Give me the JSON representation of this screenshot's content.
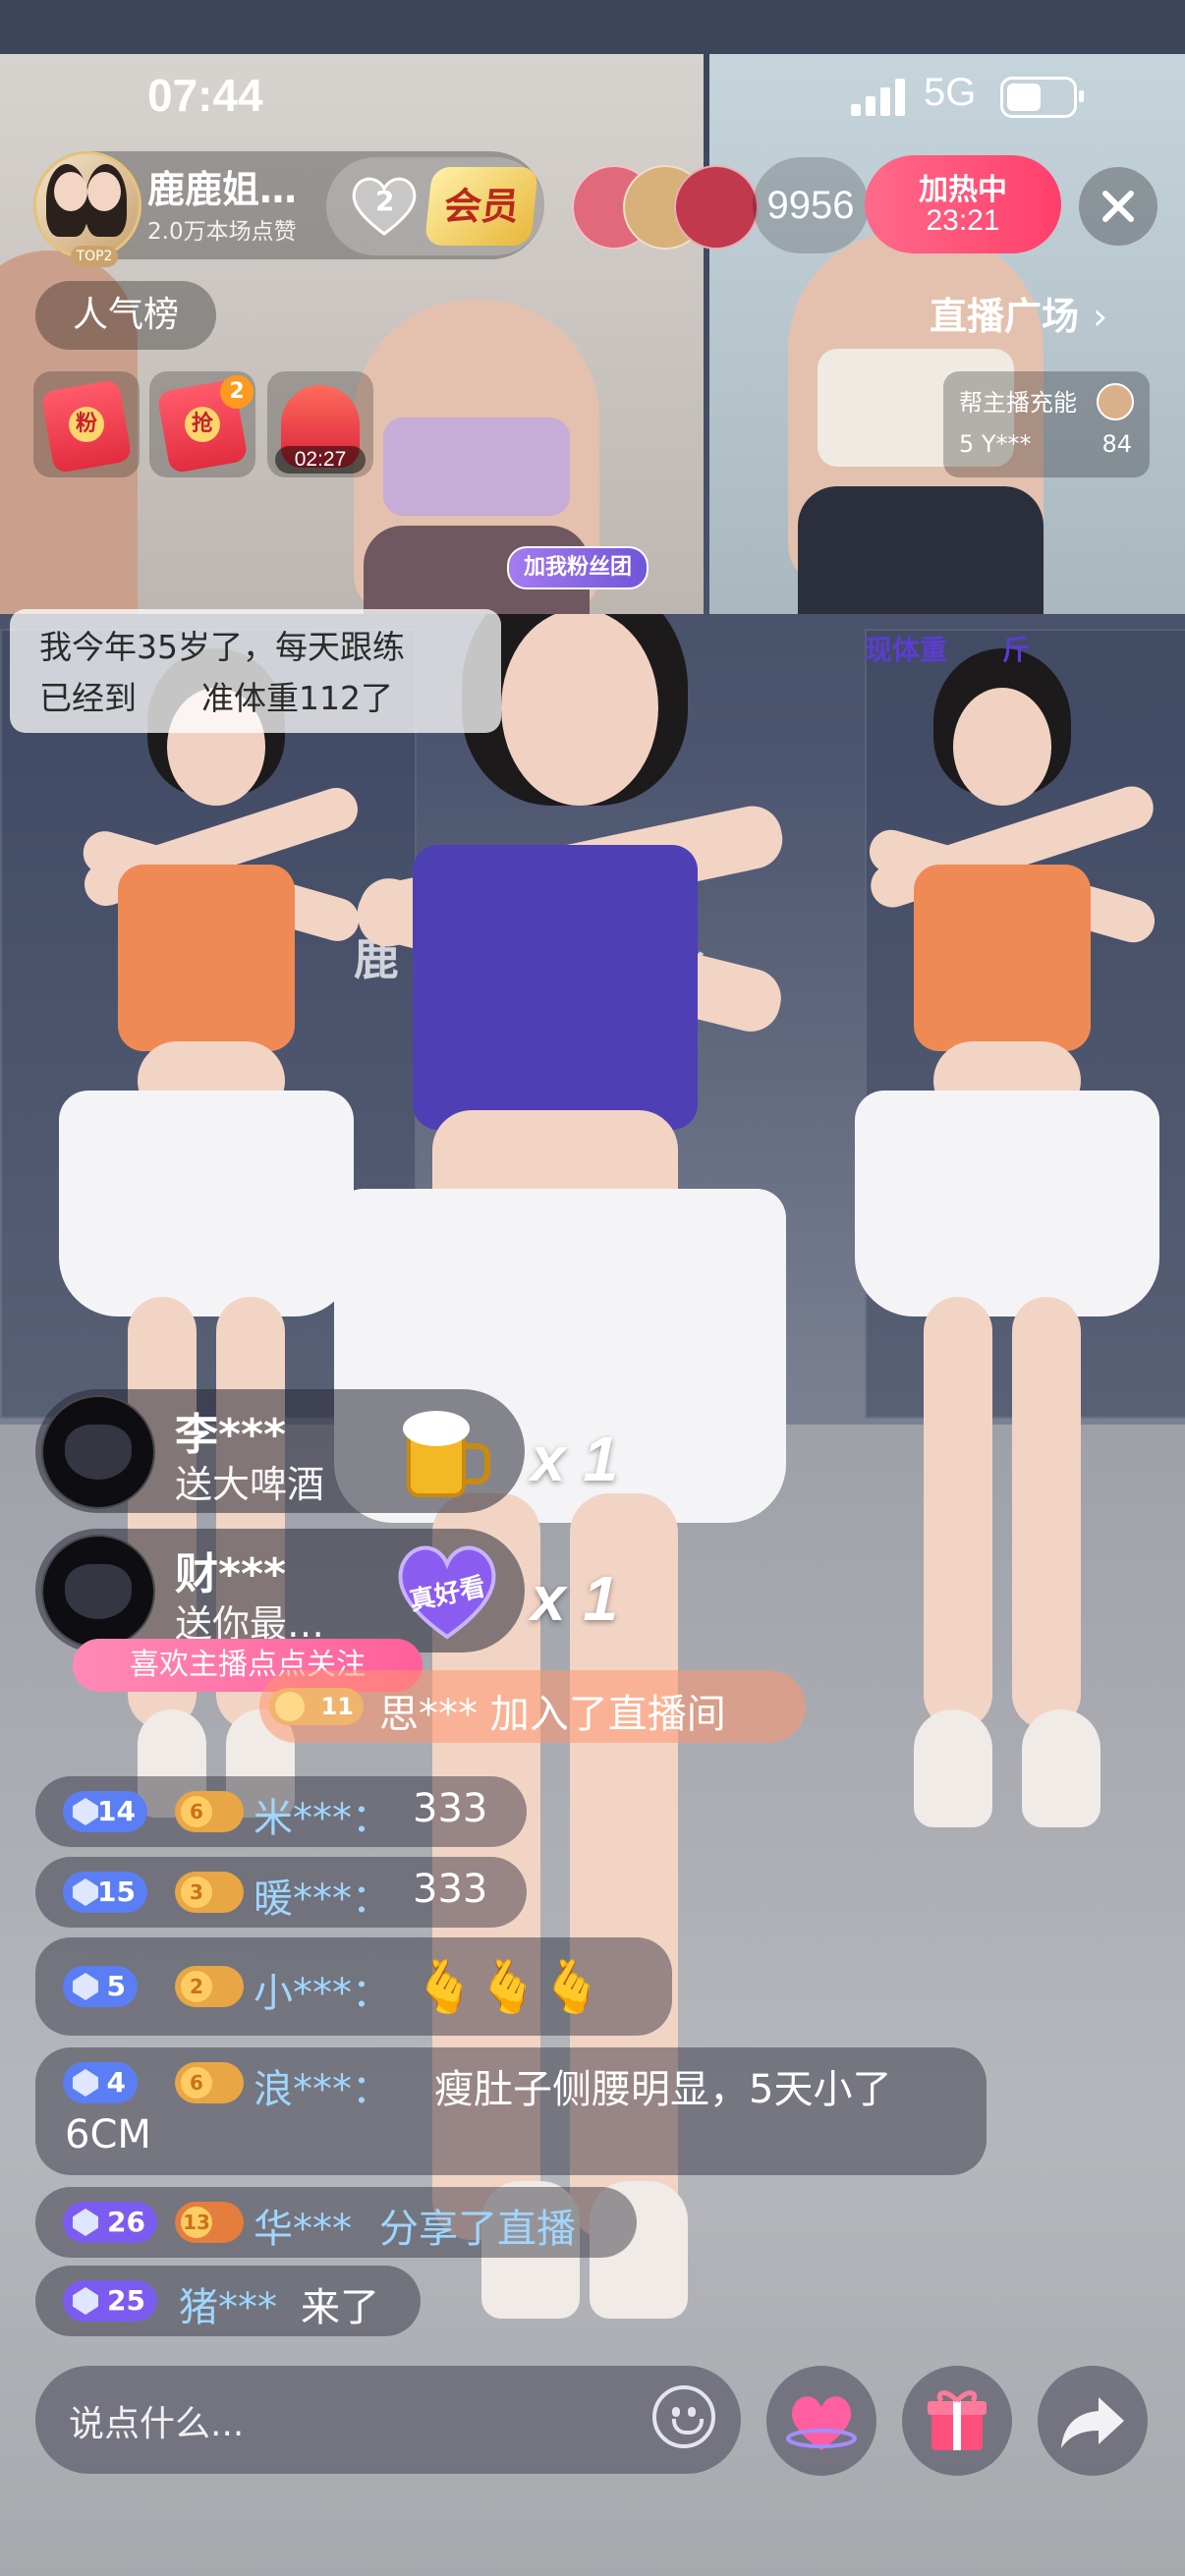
{
  "status_bar": {
    "time": "07:44",
    "network": "5G"
  },
  "host": {
    "name": "鹿鹿姐…",
    "likes": "2.0万本场点赞",
    "rank_badge": "TOP2",
    "fan_level": "2",
    "vip_label": "会员"
  },
  "viewer_count": "9956",
  "heat": {
    "label": "加热中",
    "timer": "23:21"
  },
  "popularity_label": "人气榜",
  "plaza_label": "直播广场",
  "red_envelopes": [
    {
      "seal": "粉",
      "badge": "",
      "timer": ""
    },
    {
      "seal": "抢",
      "badge": "2",
      "timer": ""
    },
    {
      "seal": "",
      "badge": "",
      "timer": "02:27"
    }
  ],
  "energy": {
    "label": "帮主播充能",
    "user": "5 Y***",
    "value": "84"
  },
  "join_fan_label": "加我粉丝团",
  "caption": {
    "line1": "我今年35岁了，每天跟练",
    "line2": "已经到　　准体重112了"
  },
  "weight_tag": "现体重　　斤",
  "wall_logo": "鹿　　　　　身",
  "gifts": [
    {
      "user": "李***",
      "action": "送大啤酒",
      "combo": "x 1",
      "gift_icon": "beer-mug-icon"
    },
    {
      "user": "财***",
      "action": "送你最…",
      "combo": "x 1",
      "gift_icon": "heart-good-look-icon",
      "gift_text": "真好看"
    }
  ],
  "follow_hint": "喜欢主播点点关注",
  "join_notice": {
    "fan_level": "11",
    "text": "思*** 加入了直播间"
  },
  "chat": [
    {
      "level": "14",
      "fan": "6",
      "user": "米***：",
      "text": "333"
    },
    {
      "level": "15",
      "fan": "3",
      "user": "暖***：",
      "text": "333"
    },
    {
      "level": "5",
      "fan": "2",
      "user": "小***：",
      "text": "🫰🫰🫰"
    },
    {
      "level": "4",
      "fan": "6",
      "user": "浪***：",
      "text": "瘦肚子侧腰明显，5天小了",
      "text2": "6CM"
    },
    {
      "level": "26",
      "fan": "13",
      "user": "华***",
      "text": "分享了直播"
    },
    {
      "level": "25",
      "fan": "",
      "user": "猪***",
      "text": "来了"
    }
  ],
  "input_placeholder": "说点什么...",
  "colors": {
    "hot": "#ff3f6b",
    "level_badge": "#5b7ef5",
    "fan_badge": "#e8a645",
    "username": "#9fd6ff"
  }
}
